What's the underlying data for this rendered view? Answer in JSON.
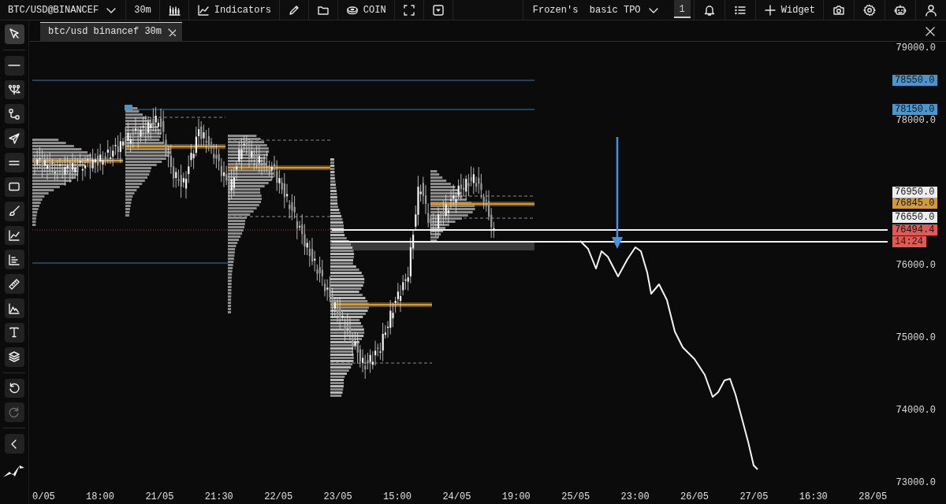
{
  "toolbar": {
    "left": [
      {
        "kind": "symbol",
        "label": "BTC/USD@BINANCEF"
      },
      {
        "kind": "interval",
        "label": "30m"
      },
      {
        "kind": "candles"
      },
      {
        "kind": "indicators",
        "label": "Indicators"
      },
      {
        "kind": "pencil"
      },
      {
        "kind": "folder"
      },
      {
        "kind": "coin",
        "label": "COIN"
      },
      {
        "kind": "fullscreen"
      },
      {
        "kind": "dropdown"
      }
    ],
    "right": [
      {
        "kind": "template",
        "label": "Frozen's  basic TPO"
      },
      {
        "kind": "layout",
        "label": "1",
        "selected": true
      },
      {
        "kind": "bell"
      },
      {
        "kind": "list"
      },
      {
        "kind": "widget",
        "label": "Widget"
      },
      {
        "kind": "camera"
      },
      {
        "kind": "gear"
      },
      {
        "kind": "robot"
      },
      {
        "kind": "user"
      }
    ]
  },
  "tabs": [
    {
      "label": "btc/usd binancef 30m",
      "selected": true
    }
  ],
  "tools": [
    {
      "kind": "cursor",
      "selected": true
    },
    {
      "kind": "line",
      "selected": false
    },
    {
      "kind": "nodes",
      "selected": false
    },
    {
      "kind": "path",
      "selected": false
    },
    {
      "kind": "send",
      "selected": false
    },
    {
      "kind": "parallel",
      "selected": false
    },
    {
      "kind": "rectangle",
      "selected": false
    },
    {
      "kind": "brush",
      "selected": false
    },
    {
      "kind": "linechart",
      "selected": false
    },
    {
      "kind": "bars",
      "selected": false
    },
    {
      "kind": "ruler",
      "selected": false
    },
    {
      "kind": "mountain",
      "selected": false
    },
    {
      "kind": "text",
      "selected": false
    },
    {
      "kind": "layers",
      "selected": false
    }
  ],
  "history": [
    {
      "kind": "undo",
      "disabled": false
    },
    {
      "kind": "redo",
      "disabled": true
    }
  ],
  "price_axis": {
    "ticks": [
      "79000.0",
      "78000.0",
      "76000.0",
      "75000.0",
      "74000.0",
      "73000.0"
    ],
    "tags": [
      {
        "text": "78550.0",
        "color": "#4c94cc"
      },
      {
        "text": "78150.0",
        "color": "#4c94cc"
      },
      {
        "text": "76950.0",
        "color": "#eeeeee"
      },
      {
        "text": "76845.0",
        "color": "#d09a3c"
      },
      {
        "text": "76650.0",
        "color": "#eeeeee"
      },
      {
        "text": "76494.4",
        "color": "#e05a55"
      },
      {
        "text": "14:24",
        "color": "#e05a55"
      }
    ]
  },
  "time_axis": [
    "0/05",
    "18:00",
    "21/05",
    "21:30",
    "22/05",
    "23/05",
    "15:00",
    "24/05",
    "19:00",
    "25/05",
    "23:00",
    "26/05",
    "27/05",
    "16:30",
    "28/05"
  ]
}
